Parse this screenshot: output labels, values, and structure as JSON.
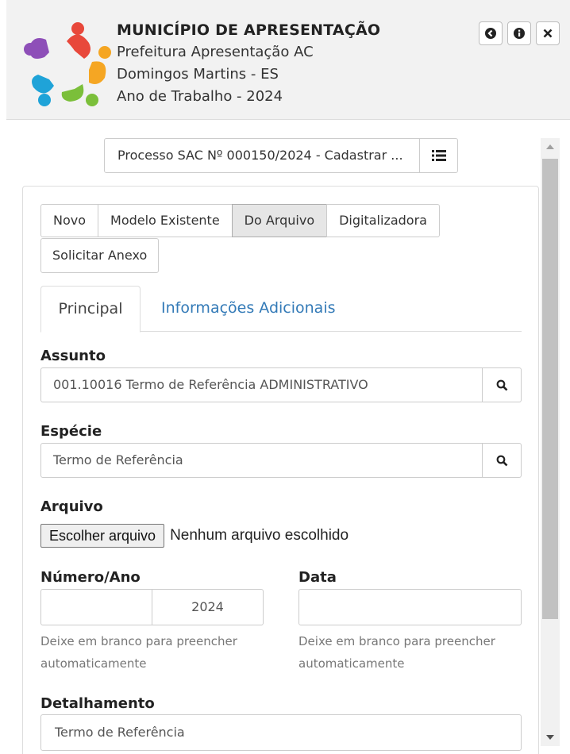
{
  "header": {
    "title": "MUNICÍPIO DE APRESENTAÇÃO",
    "line1": "Prefeitura Apresentação AC",
    "line2": "Domingos Martins - ES",
    "line3": "Ano de Trabalho - 2024",
    "buttons": [
      "back-icon",
      "info-icon",
      "close-icon"
    ]
  },
  "process": {
    "label": "Processo SAC Nº 000150/2024 - Cadastrar ...",
    "icon": "list-icon"
  },
  "attach_options": {
    "buttons": [
      "Novo",
      "Modelo Existente",
      "Do Arquivo",
      "Digitalizadora"
    ],
    "active": "Do Arquivo",
    "extra": "Solicitar Anexo"
  },
  "tabs": {
    "principal": "Principal",
    "adicionais": "Informações Adicionais"
  },
  "form": {
    "assunto_label": "Assunto",
    "assunto_value": "001.10016 Termo de Referência  ADMINISTRATIVO",
    "especie_label": "Espécie",
    "especie_value": "Termo de Referência",
    "arquivo_label": "Arquivo",
    "file_button": "Escolher arquivo",
    "file_status": "Nenhum arquivo escolhido",
    "numero_label": "Número/Ano",
    "numero_value": "",
    "ano_value": "2024",
    "data_label": "Data",
    "data_value": "",
    "help_text": "Deixe em branco para preencher automaticamente",
    "detalhamento_label": "Detalhamento",
    "detalhamento_value": "Termo de Referência"
  },
  "colors": {
    "link": "#337ab7",
    "active_button": "#e6e6e6",
    "header_bg": "#f2f2f2"
  }
}
